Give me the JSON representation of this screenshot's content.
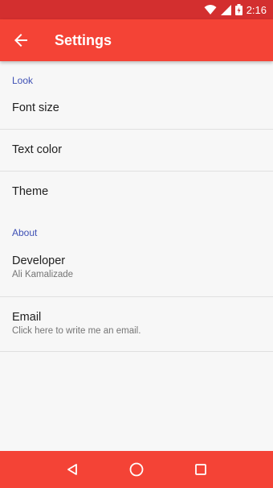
{
  "status_bar": {
    "time": "2:16",
    "icons": [
      "wifi-icon",
      "signal-icon",
      "battery-icon"
    ]
  },
  "app_bar": {
    "title": "Settings",
    "back_icon": "arrow-back-icon"
  },
  "sections": [
    {
      "header": "Look",
      "items": [
        {
          "title": "Font size"
        },
        {
          "title": "Text color"
        },
        {
          "title": "Theme"
        }
      ]
    },
    {
      "header": "About",
      "items": [
        {
          "title": "Developer",
          "summary": "Ali Kamalizade"
        },
        {
          "title": "Email",
          "summary": "Click here to write me an email."
        }
      ]
    }
  ],
  "nav_bar": {
    "buttons": [
      "back-triangle-icon",
      "home-circle-icon",
      "recents-square-icon"
    ]
  },
  "colors": {
    "primary": "#f44336",
    "primary_dark": "#d32f2f",
    "accent_header": "#3f51b5",
    "background": "#f7f7f7"
  }
}
